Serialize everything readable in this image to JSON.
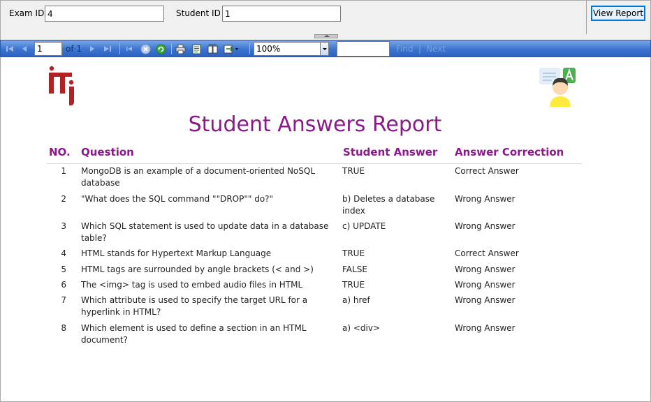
{
  "parameters": {
    "exam_id_label": "Exam ID",
    "exam_id_value": "4",
    "student_id_label": "Student ID",
    "student_id_value": "1",
    "view_report_label": "View Report"
  },
  "toolbar": {
    "page_value": "1",
    "of_label": "of  1",
    "zoom_value": "100%",
    "find_value": "",
    "find_label": "Find",
    "find_sep": "|",
    "next_label": "Next"
  },
  "report": {
    "title": "Student Answers Report",
    "columns": {
      "no": "NO.",
      "question": "Question",
      "student_answer": "Student Answer",
      "correction": "Answer Correction"
    },
    "rows": [
      {
        "no": "1",
        "question": "MongoDB is an example of a document-oriented NoSQL database",
        "student_answer": "TRUE",
        "correction": "Correct Answer"
      },
      {
        "no": "2",
        "question": "\"What does the SQL command \"\"DROP\"\" do?\"",
        "student_answer": "b) Deletes a database index",
        "correction": "Wrong Answer"
      },
      {
        "no": "3",
        "question": "Which SQL statement is used to update data in a database table?",
        "student_answer": "c) UPDATE",
        "correction": "Wrong Answer"
      },
      {
        "no": "4",
        "question": "HTML stands for Hypertext Markup Language",
        "student_answer": "TRUE",
        "correction": "Correct Answer"
      },
      {
        "no": "5",
        "question": "HTML tags are surrounded by angle brackets (< and >)",
        "student_answer": "FALSE",
        "correction": "Wrong Answer"
      },
      {
        "no": "6",
        "question": "The <img> tag is used to embed audio files in HTML",
        "student_answer": "TRUE",
        "correction": "Wrong Answer"
      },
      {
        "no": "7",
        "question": "Which attribute is used to specify the target URL for a hyperlink in HTML?",
        "student_answer": "a) href",
        "correction": "Wrong Answer"
      },
      {
        "no": "8",
        "question": "Which element is used to define a section in an HTML document?",
        "student_answer": "a) <div>",
        "correction": "Wrong Answer"
      }
    ]
  },
  "colors": {
    "title": "#8a1a8a",
    "logo": "#b22222",
    "toolbar": "#3c74d0",
    "avatar_accent": "#4caf50"
  },
  "icons": {
    "first_page": "first-page-icon",
    "prev_page": "previous-page-icon",
    "next_page": "next-page-icon",
    "last_page": "last-page-icon",
    "back": "back-icon",
    "stop": "stop-icon",
    "refresh": "refresh-icon",
    "print": "print-icon",
    "print_layout": "print-layout-icon",
    "page_setup": "page-setup-icon",
    "export": "export-icon"
  }
}
